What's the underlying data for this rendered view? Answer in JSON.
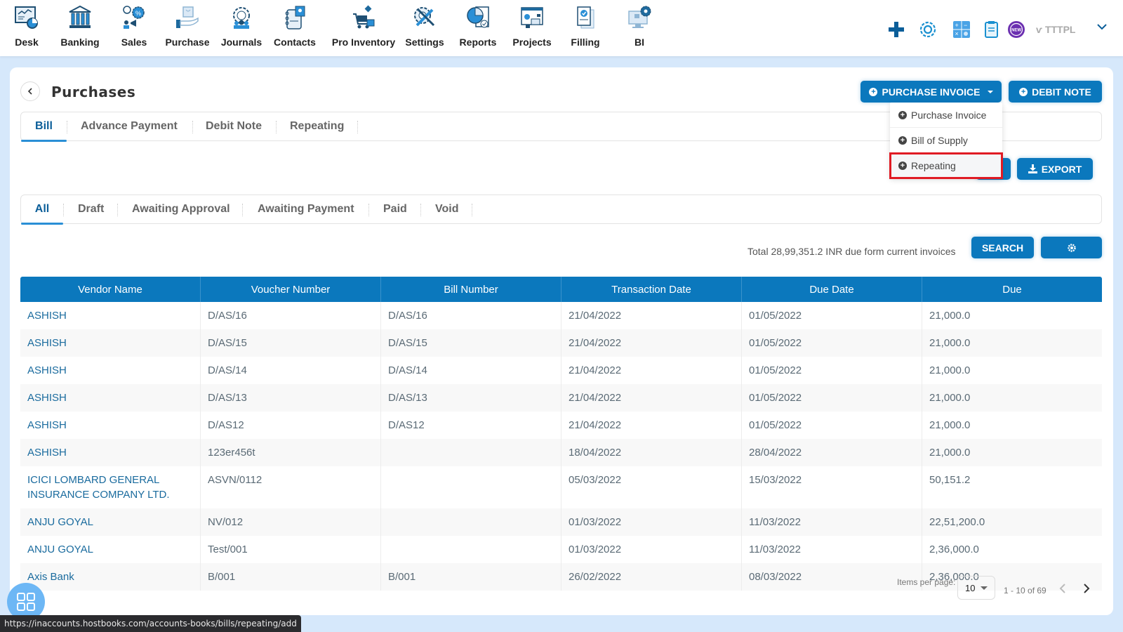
{
  "nav": {
    "items": [
      {
        "label": "Desk",
        "icon": "desk-icon"
      },
      {
        "label": "Banking",
        "icon": "bank-icon"
      },
      {
        "label": "Sales",
        "icon": "sales-icon"
      },
      {
        "label": "Purchase",
        "icon": "purchase-icon"
      },
      {
        "label": "Journals",
        "icon": "journals-icon"
      },
      {
        "label": "Contacts",
        "icon": "contacts-icon"
      },
      {
        "label": "Pro Inventory",
        "icon": "inventory-icon"
      },
      {
        "label": "Settings",
        "icon": "settings-icon"
      },
      {
        "label": "Reports",
        "icon": "reports-icon"
      },
      {
        "label": "Projects",
        "icon": "projects-icon"
      },
      {
        "label": "Filling",
        "icon": "filling-icon"
      },
      {
        "label": "BI",
        "icon": "bi-icon"
      }
    ],
    "tools": [
      "plus-icon",
      "gear-icon",
      "calculator-icon",
      "notes-icon",
      "new-badge-icon"
    ],
    "new_badge": "NEW",
    "org_name": "ѵ TTTPL"
  },
  "page": {
    "title": "Purchases",
    "purchase_invoice_button": "PURCHASE INVOICE",
    "debit_note_button": "DEBIT NOTE",
    "export_button": "EXPORT",
    "search_button": "SEARCH",
    "total_text": "Total 28,99,351.2 INR due form current invoices"
  },
  "main_tabs": [
    {
      "label": "Bill",
      "active": true
    },
    {
      "label": "Advance Payment",
      "active": false
    },
    {
      "label": "Debit Note",
      "active": false
    },
    {
      "label": "Repeating",
      "active": false
    }
  ],
  "status_tabs": [
    {
      "label": "All",
      "active": true
    },
    {
      "label": "Draft",
      "active": false
    },
    {
      "label": "Awaiting Approval",
      "active": false
    },
    {
      "label": "Awaiting Payment",
      "active": false
    },
    {
      "label": "Paid",
      "active": false
    },
    {
      "label": "Void",
      "active": false
    }
  ],
  "dropdown": {
    "items": [
      {
        "label": "Purchase Invoice",
        "highlighted": false
      },
      {
        "label": "Bill of Supply",
        "highlighted": false
      },
      {
        "label": "Repeating",
        "highlighted": true
      }
    ]
  },
  "table": {
    "columns": [
      "Vendor Name",
      "Voucher Number",
      "Bill Number",
      "Transaction Date",
      "Due Date",
      "Due"
    ],
    "rows": [
      [
        "ASHISH",
        "D/AS/16",
        "D/AS/16",
        "21/04/2022",
        "01/05/2022",
        "21,000.0"
      ],
      [
        "ASHISH",
        "D/AS/15",
        "D/AS/15",
        "21/04/2022",
        "01/05/2022",
        "21,000.0"
      ],
      [
        "ASHISH",
        "D/AS/14",
        "D/AS/14",
        "21/04/2022",
        "01/05/2022",
        "21,000.0"
      ],
      [
        "ASHISH",
        "D/AS/13",
        "D/AS/13",
        "21/04/2022",
        "01/05/2022",
        "21,000.0"
      ],
      [
        "ASHISH",
        "D/AS12",
        "D/AS12",
        "21/04/2022",
        "01/05/2022",
        "21,000.0"
      ],
      [
        "ASHISH",
        "123er456t",
        "",
        "18/04/2022",
        "28/04/2022",
        "21,000.0"
      ],
      [
        "ICICI LOMBARD GENERAL INSURANCE COMPANY LTD.",
        "ASVN/0112",
        "",
        "05/03/2022",
        "15/03/2022",
        "50,151.2"
      ],
      [
        "ANJU GOYAL",
        "NV/012",
        "",
        "01/03/2022",
        "11/03/2022",
        "22,51,200.0"
      ],
      [
        "ANJU GOYAL",
        "Test/001",
        "",
        "01/03/2022",
        "11/03/2022",
        "2,36,000.0"
      ],
      [
        "Axis Bank",
        "B/001",
        "B/001",
        "26/02/2022",
        "08/03/2022",
        "2,36,000.0"
      ]
    ]
  },
  "pagination": {
    "items_per_page_label": "Items per page:",
    "items_per_page": "10",
    "range_text": "1 - 10 of 69"
  },
  "status_bar": {
    "url": "https://inaccounts.hostbooks.com/accounts-books/bills/repeating/add"
  },
  "colors": {
    "primary": "#0b78bd",
    "highlight_border": "#e01b24",
    "vendor_link": "#1a6b9e"
  }
}
